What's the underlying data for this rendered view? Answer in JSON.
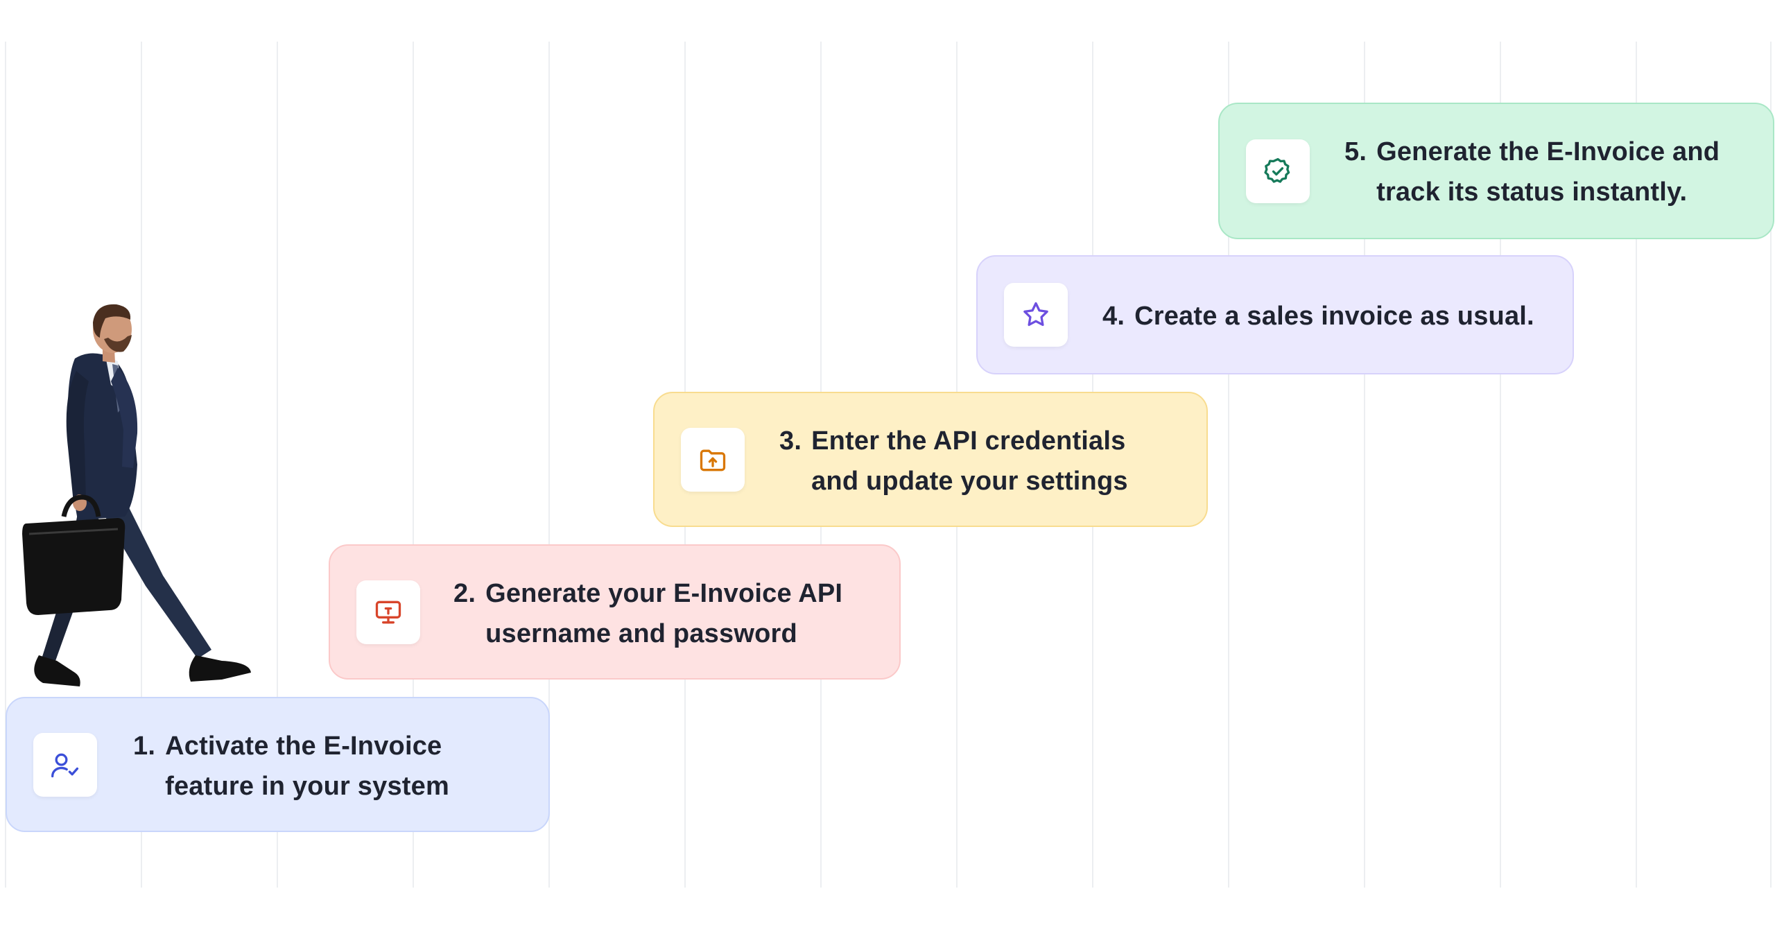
{
  "steps": [
    {
      "number": "1.",
      "text": "Activate the E-Invoice feature in your system",
      "icon": "user-check-icon",
      "color": "#3b4fd8",
      "background": "#e3eafe"
    },
    {
      "number": "2.",
      "text": "Generate your E-Invoice API username and password",
      "icon": "monitor-icon",
      "color": "#d8452b",
      "background": "#fee2e2"
    },
    {
      "number": "3.",
      "text": "Enter the API credentials and update your settings",
      "icon": "folder-upload-icon",
      "color": "#d97706",
      "background": "#fef0c6"
    },
    {
      "number": "4.",
      "text": "Create a sales invoice as usual.",
      "icon": "star-icon",
      "color": "#6d4fe0",
      "background": "#ebe9fe"
    },
    {
      "number": "5.",
      "text": "Generate the E-Invoice and track its status instantly.",
      "icon": "badge-check-icon",
      "color": "#167a5a",
      "background": "#d2f5e2"
    }
  ]
}
